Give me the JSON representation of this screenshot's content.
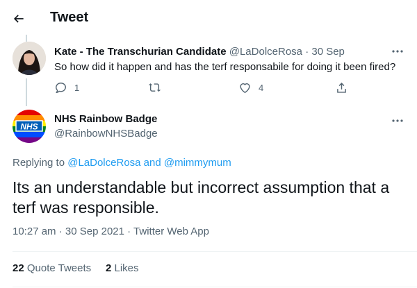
{
  "header": {
    "title": "Tweet"
  },
  "parent_tweet": {
    "name": "Kate - The Transchurian Candidate",
    "handle": "@LaDolceRosa",
    "separator": "·",
    "date": "30 Sep",
    "text": "So how did it happen and has the terf responsabile for doing it been fired?",
    "replies": "1",
    "likes": "4"
  },
  "main_tweet": {
    "name": "NHS Rainbow Badge",
    "handle": "@RainbowNHSBadge",
    "avatar_text": "NHS",
    "replying_prefix": "Replying to",
    "reply_to_1": "@LaDolceRosa",
    "reply_and": "and",
    "reply_to_2": "@mimmymum",
    "text": "Its an understandable but incorrect assumption that a terf was responsible.",
    "time": "10:27 am",
    "date": "30 Sep 2021",
    "source": "Twitter Web App",
    "separator": "·",
    "quote_tweets_count": "22",
    "quote_tweets_label": "Quote Tweets",
    "likes_count": "2",
    "likes_label": "Likes"
  },
  "colors": {
    "accent": "#1d9bf0",
    "text": "#0f1419",
    "secondary": "#536471",
    "divider": "#eff3f4",
    "nhs_blue": "#005eb8"
  },
  "icons": {
    "back": "arrow-left-icon",
    "more": "more-icon",
    "reply": "reply-icon",
    "retweet": "retweet-icon",
    "like": "heart-icon",
    "share": "share-icon"
  }
}
